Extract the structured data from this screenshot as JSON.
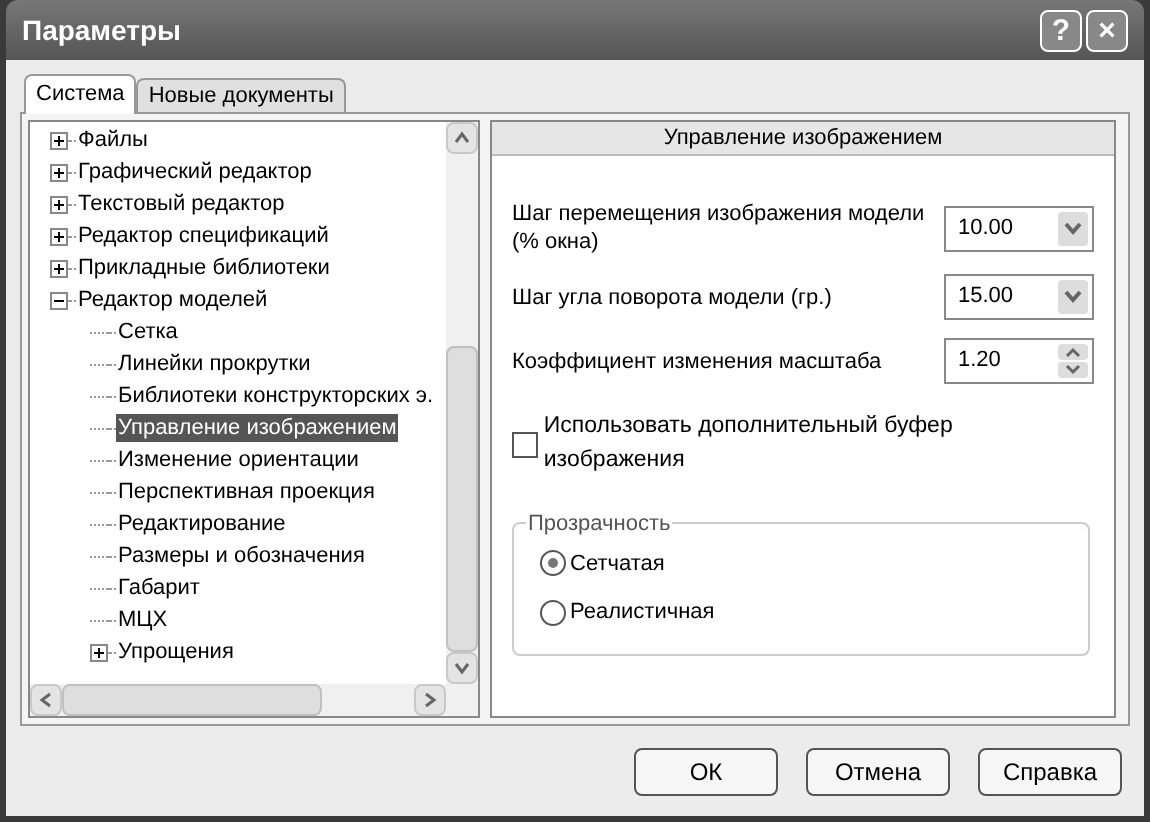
{
  "window": {
    "title": "Параметры",
    "buttons": [
      "?",
      "×"
    ]
  },
  "tabs": [
    {
      "label": "Система",
      "selected": true
    },
    {
      "label": "Новые документы",
      "selected": false
    }
  ],
  "tree": [
    {
      "label": "Файлы",
      "kind": "folder",
      "expanded": false,
      "selected": false
    },
    {
      "label": "Графический редактор",
      "kind": "folder",
      "expanded": false,
      "selected": false
    },
    {
      "label": "Текстовый редактор",
      "kind": "folder",
      "expanded": false,
      "selected": false
    },
    {
      "label": "Редактор спецификаций",
      "kind": "folder",
      "expanded": false,
      "selected": false
    },
    {
      "label": "Прикладные библиотеки",
      "kind": "folder",
      "expanded": false,
      "selected": false
    },
    {
      "label": "Редактор моделей",
      "kind": "folder",
      "expanded": true,
      "selected": false,
      "children": [
        {
          "label": "Сетка",
          "kind": "leaf",
          "selected": false
        },
        {
          "label": "Линейки прокрутки",
          "kind": "leaf",
          "selected": false
        },
        {
          "label": "Библиотеки конструкторских э.",
          "kind": "leaf",
          "selected": false
        },
        {
          "label": "Управление изображением",
          "kind": "leaf",
          "selected": true
        },
        {
          "label": "Изменение ориентации",
          "kind": "leaf",
          "selected": false
        },
        {
          "label": "Перспективная проекция",
          "kind": "leaf",
          "selected": false
        },
        {
          "label": "Редактирование",
          "kind": "leaf",
          "selected": false
        },
        {
          "label": "Размеры и обозначения",
          "kind": "leaf",
          "selected": false
        },
        {
          "label": "Габарит",
          "kind": "leaf",
          "selected": false
        },
        {
          "label": "МЦХ",
          "kind": "leaf",
          "selected": false
        },
        {
          "label": "Упрощения",
          "kind": "folder",
          "expanded": false,
          "selected": false
        }
      ]
    }
  ],
  "panel": {
    "title": "Управление изображением",
    "fields": [
      {
        "label": "Шаг перемещения изображения модели (% окна)",
        "value": "10.00",
        "kind": "dropdown"
      },
      {
        "label": "Шаг угла поворота модели (гр.)",
        "value": "15.00",
        "kind": "dropdown"
      },
      {
        "label": "Коэффициент изменения масштаба",
        "value": "1.20",
        "kind": "spin"
      }
    ],
    "checkbox": {
      "label": "Использовать дополнительный буфер изображения",
      "checked": false
    },
    "group": {
      "title": "Прозрачность",
      "options": [
        {
          "label": "Сетчатая",
          "selected": true
        },
        {
          "label": "Реалистичная",
          "selected": false
        }
      ]
    }
  },
  "buttons": [
    "ОК",
    "Отмена",
    "Справка"
  ]
}
